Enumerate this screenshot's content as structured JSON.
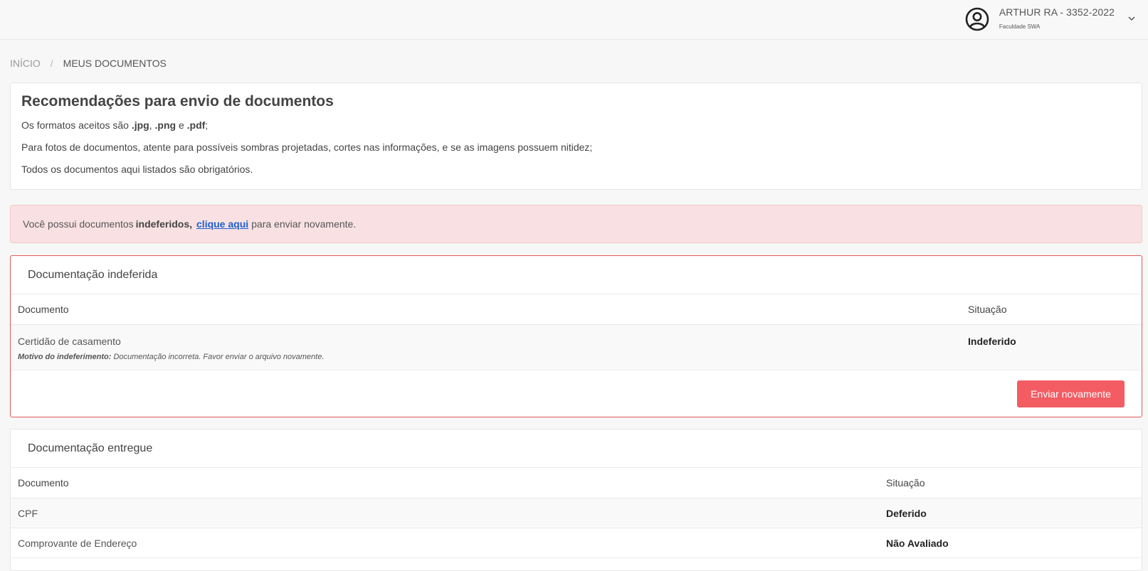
{
  "user": {
    "name": "ARTHUR RA - 3352-2022",
    "institution": "Faculdade SWA"
  },
  "breadcrumb": {
    "home": "INÍCIO",
    "separator": "/",
    "current": "MEUS DOCUMENTOS"
  },
  "recommendations": {
    "title": "Recomendações para envio de documentos",
    "formats_prefix": "Os formatos aceitos são ",
    "fmt_jpg": ".jpg",
    "comma": ", ",
    "fmt_png": ".png",
    "and": " e ",
    "fmt_pdf": ".pdf",
    "semicolon": ";",
    "photos": "Para fotos de documentos, atente para possíveis sombras projetadas, cortes nas informações, e se as imagens possuem nitidez;",
    "required": "Todos os documentos aqui listados são obrigatórios."
  },
  "alert": {
    "prefix": "Você possui documentos",
    "bold": "indeferidos,",
    "link": "clique aqui",
    "suffix": "para enviar novamente."
  },
  "rejected": {
    "title": "Documentação indeferida",
    "col_document": "Documento",
    "col_status": "Situação",
    "rows": [
      {
        "document": "Certidão de casamento",
        "reason_label": "Motivo do indeferimento:",
        "reason": " Documentação incorreta. Favor enviar o arquivo novamente.",
        "status": "Indeferido"
      }
    ],
    "resend_button": "Enviar novamente"
  },
  "delivered": {
    "title": "Documentação entregue",
    "col_document": "Documento",
    "col_status": "Situação",
    "rows": [
      {
        "document": "CPF",
        "status": "Deferido"
      },
      {
        "document": "Comprovante de Endereço",
        "status": "Não Avaliado"
      }
    ]
  },
  "icons": {
    "avatar": "user-circle-icon",
    "menu": "chevron-down-icon"
  },
  "colors": {
    "accent_red": "#f35c63",
    "alert_bg": "#f9e1e3",
    "rejected_border": "#e05a5a",
    "link": "#1f5ecf"
  }
}
